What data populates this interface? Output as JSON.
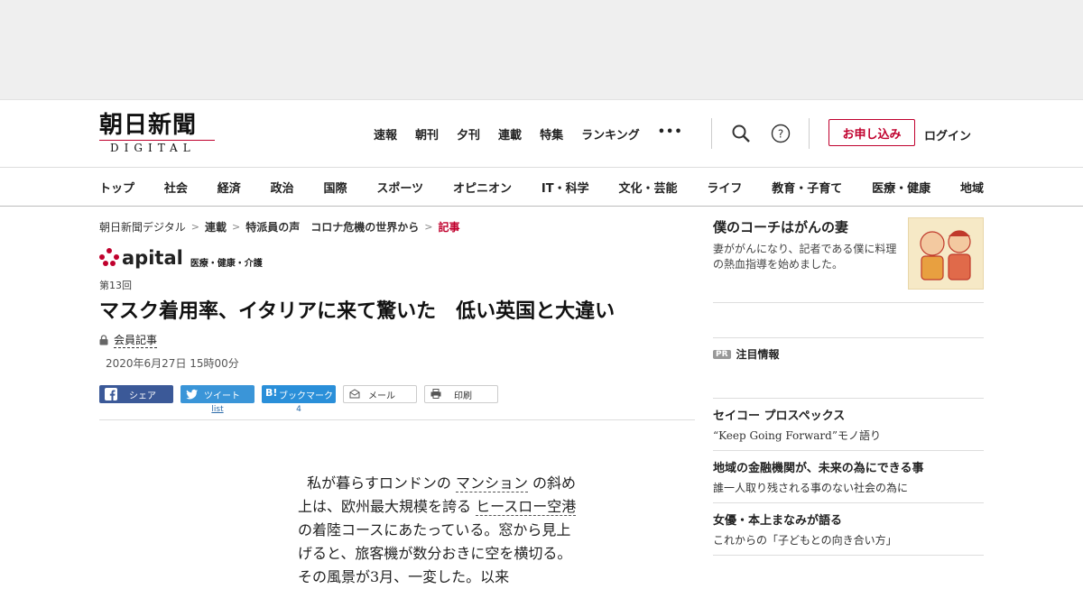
{
  "header": {
    "logo_jp": "朝日新聞",
    "logo_en": "DIGITAL",
    "nav": [
      "速報",
      "朝刊",
      "夕刊",
      "連載",
      "特集",
      "ランキング"
    ],
    "more": "•••",
    "subscribe": "お申し込み",
    "login": "ログイン"
  },
  "categories": [
    "トップ",
    "社会",
    "経済",
    "政治",
    "国際",
    "スポーツ",
    "オピニオン",
    "IT・科学",
    "文化・芸能",
    "ライフ",
    "教育・子育て",
    "医療・健康",
    "地域"
  ],
  "breadcrumb": [
    "朝日新聞デジタル",
    "連載",
    "特派員の声　コロナ危機の世界から",
    "記事"
  ],
  "apital": {
    "word": "apital",
    "tag": "医療・健康・介護"
  },
  "article": {
    "series_no": "第13回",
    "title": "マスク着用率、イタリアに来て驚いた　低い英国と大違い",
    "member": "会員記事",
    "date": "2020年6月27日 15時00分",
    "body_1": "私が暮らすロンドンの ",
    "body_link1": "マンション",
    "body_2": " の斜め上は、欧州最大規模を誇る ",
    "body_link2": "ヒースロー空港",
    "body_3": " の着陸コースにあたっている。窓から見上げると、旅客機が数分おきに空を横切る。その風景が3月、一変した。以来"
  },
  "share": {
    "facebook": "シェア",
    "twitter": "ツイート",
    "hatena": "ブックマーク",
    "mail": "メール",
    "print": "印刷",
    "twitter_count": "list",
    "hatena_count": "4"
  },
  "sidebar": {
    "promo_title": "僕のコーチはがんの妻",
    "promo_desc": "妻ががんになり、記者である僕に料理の熱血指導を始めました。",
    "pr_badge": "PR",
    "pr_label": "注目情報",
    "ads": [
      {
        "title": "セイコー プロスペックス",
        "desc": "“Keep Going Forward”モノ語り"
      },
      {
        "title": "地域の金融機関が、未来の為にできる事",
        "desc": "誰一人取り残される事のない社会の為に"
      },
      {
        "title": "女優・本上まなみが語る",
        "desc": "これからの「子どもとの向き合い方」"
      }
    ]
  },
  "colors": {
    "accent": "#c0002d",
    "facebook": "#3b5998",
    "twitter": "#3a95d8",
    "hatena": "#2a8fd9"
  }
}
